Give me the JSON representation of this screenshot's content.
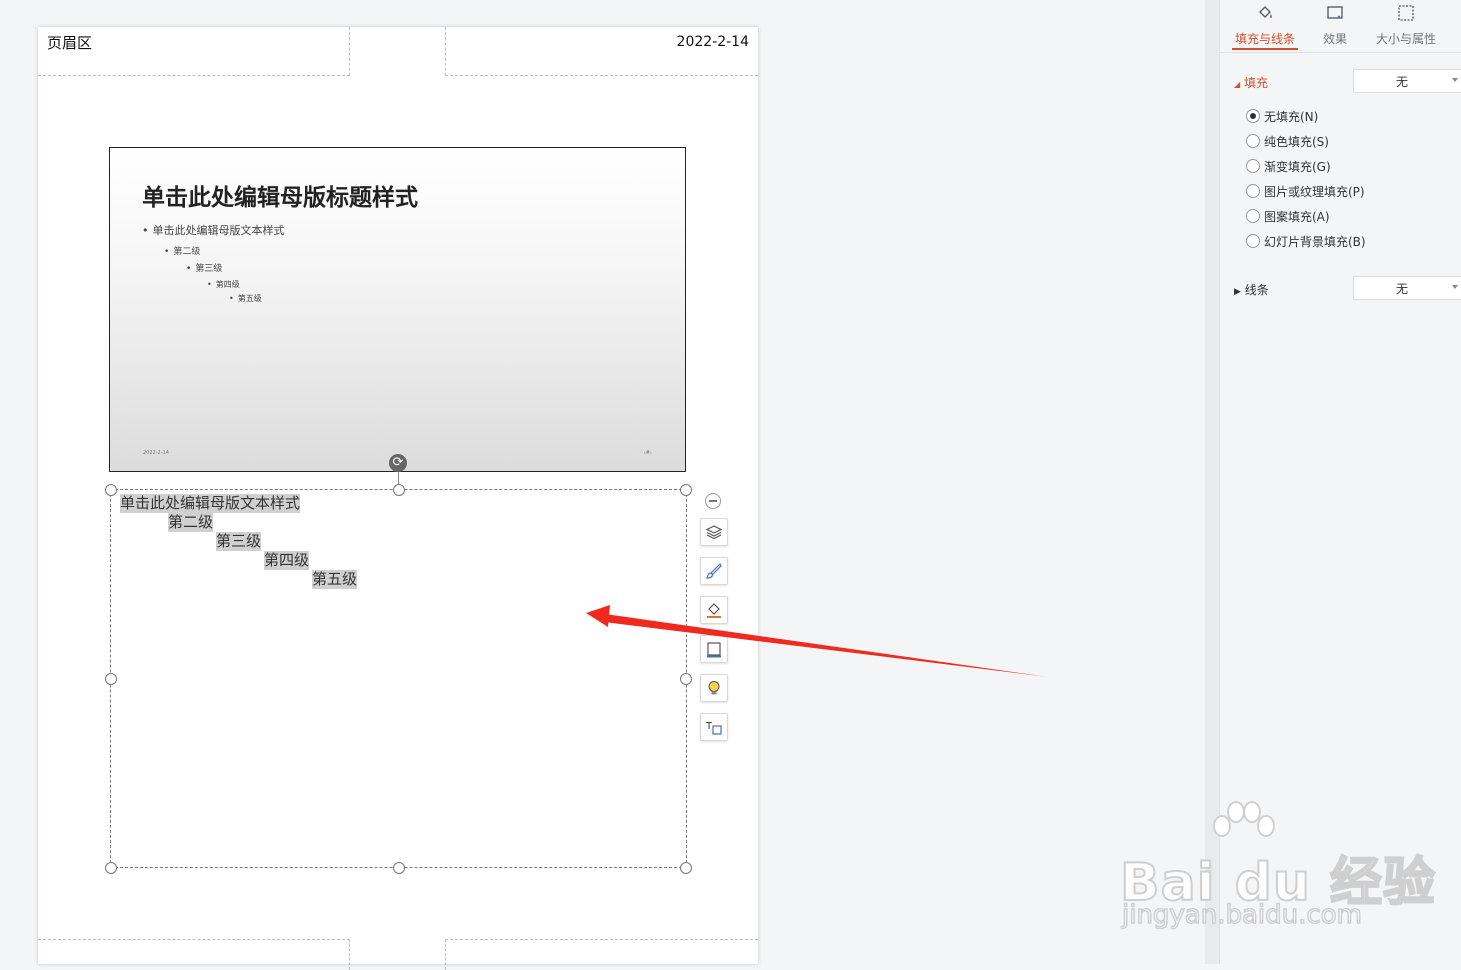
{
  "page": {
    "header_left": "页眉区",
    "header_right": "2022-2-14"
  },
  "slide": {
    "title": "单击此处编辑母版标题样式",
    "levels": [
      "单击此处编辑母版文本样式",
      "第二级",
      "第三级",
      "第四级",
      "第五级"
    ],
    "date": "2022-2-14",
    "number": "‹#›"
  },
  "notes": {
    "levels": [
      "单击此处编辑母版文本样式",
      "第二级",
      "第三级",
      "第四级",
      "第五级"
    ]
  },
  "floating_toolbar": {
    "icons": [
      "layers-icon",
      "brush-icon",
      "fill-bucket-icon",
      "border-frame-icon",
      "lightbulb-icon",
      "text-box-icon"
    ]
  },
  "panel": {
    "tabs": [
      {
        "label": "填充与线条",
        "icon": "fill-line-icon",
        "active": true
      },
      {
        "label": "效果",
        "icon": "effects-icon",
        "active": false
      },
      {
        "label": "大小与属性",
        "icon": "size-props-icon",
        "active": false
      }
    ],
    "fill": {
      "title": "填充",
      "dropdown_value": "无",
      "options": [
        {
          "label": "无填充(N)",
          "selected": true
        },
        {
          "label": "纯色填充(S)",
          "selected": false
        },
        {
          "label": "渐变填充(G)",
          "selected": false
        },
        {
          "label": "图片或纹理填充(P)",
          "selected": false
        },
        {
          "label": "图案填充(A)",
          "selected": false
        },
        {
          "label": "幻灯片背景填充(B)",
          "selected": false
        }
      ]
    },
    "line": {
      "title": "线条",
      "dropdown_value": "无"
    }
  },
  "watermark": {
    "text": "Bai du 经验",
    "url": "jingyan.baidu.com"
  },
  "colors": {
    "accent": "#d4502b",
    "arrow": "#f02a1e"
  }
}
